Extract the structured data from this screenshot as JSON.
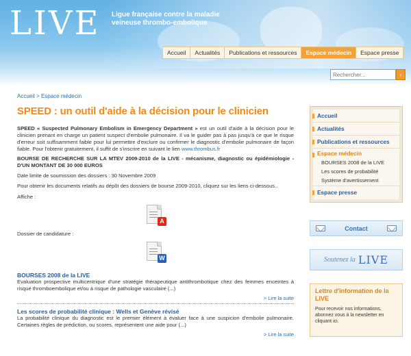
{
  "header": {
    "logo": "LIVE",
    "tagline_line1": "Ligue française contre la maladie",
    "tagline_line2": "veineuse thrombo-embolique"
  },
  "topnav": [
    "Accueil",
    "Actualités",
    "Publications et ressources",
    "Espace médecin",
    "Espace presse"
  ],
  "topnav_active": "Espace médecin",
  "search": {
    "placeholder": "Rechercher...",
    "button_icon": "arrow-right-icon"
  },
  "breadcrumb": {
    "home": "Accueil",
    "separator": ">",
    "current": "Espace médecin"
  },
  "main": {
    "title": "SPEED : un outil d'aide à la décision pour le clinicien",
    "intro_bold": "SPEED « Suspected Pulmonary Embolism in Emergency Department »",
    "intro_text": " est un outil d'aide à la décision pour le clinicien prenant en charge un patient suspect d'embolie pulmonaire. Il va le guider pas à pas jusqu'à ce que le risque d'erreur soit suffisamment faible pour lui permettre d'exclure ou confirmer le diagnostic d'embolie pulmonaire de façon fiable. Pour l'obtenir gratuitement, il suffit de s'inscrire en suivant le lien ",
    "intro_link": "www.thrombus.fr",
    "bourse_title": "BOURSE DE RECHERCHE SUR LA MTEV 2009-2010 de la LIVE - mécanisme, diagnostic ou épidémiologie - D'UN MONTANT DE 30 000 EUROS",
    "deadline": "Date limite de soumission des dossiers : 30 Novembre 2009",
    "download_text": "Pour obtenir les documents relatifs au dépôt des dossiers de bourse 2009-2010, cliquez sur les liens ci-dessous..",
    "affiche_label": "Affiche :",
    "dossier_label": "Dossier de candidature :",
    "pdf_badge": "A",
    "word_badge": "W",
    "news": [
      {
        "title": "BOURSES 2008 de la LIVE",
        "text": "Evaluation prospective multicentrique d'une stratégie thérapeutique antithrombotique chez des femmes enceintes à risqué thromboembolique et/ou à risque de pathologie vasculaire (...)",
        "more": "> Lire la suite"
      },
      {
        "title": "Les scores de probabilité clinique : Wells et Genève révisé",
        "text": "La probabilité clinique du diagnostic est le premier élément à évaluer face à une suspicion d'embolie pulmonaire. Certaines règles de prédiction, ou scores, représentent une aide pour (...)",
        "more": "> Lire la suite"
      }
    ]
  },
  "sidebar": {
    "items": [
      "Accueil",
      "Actualités",
      "Publications et ressources",
      "Espace médecin",
      "Espace presse"
    ],
    "sub_items": [
      "BOURSES 2008 de la LIVE",
      "Les scores de probabilité",
      "Système d'avertissement"
    ],
    "contact": "Contact",
    "soutenez": "Soutenez la",
    "soutenez_logo": "LIVE",
    "newsletter_title": "Lettre d'information de la LIVE",
    "newsletter_text": "Pour recevoir nos informations, abonnez vous à la newsletter en cliquant ici."
  },
  "colors": {
    "accent_orange": "#f08a1a",
    "link_blue": "#2a5d9a",
    "header_blue": "#5fb0e3"
  }
}
